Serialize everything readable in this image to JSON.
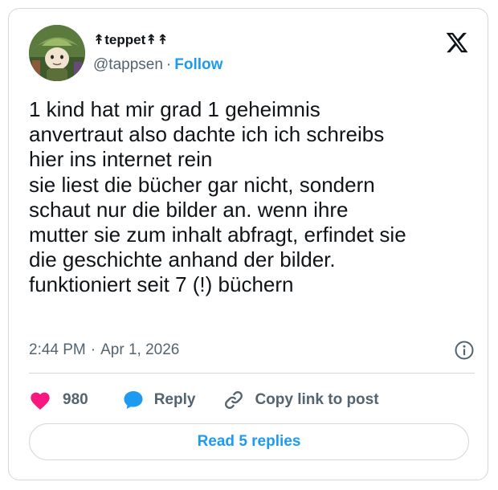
{
  "author": {
    "display_name": "↟teppet↟↟",
    "handle": "@tappsen",
    "separator": "·",
    "follow_label": "Follow",
    "avatar": "avatar-illustration"
  },
  "brand": {
    "logo": "x-logo-icon"
  },
  "tweet": {
    "text": "1 kind hat mir grad 1 geheimnis\nanvertraut also dachte ich ich schreibs\nhier ins internet rein\nsie liest die bücher gar nicht, sondern\nschaut nur die bilder an. wenn ihre\nmutter sie zum inhalt abfragt, erfindet sie\ndie geschichte anhand der bilder.\nfunktioniert seit 7 (!) büchern",
    "time": "2:44 PM",
    "separator": "·",
    "date": "Apr 1, 2026",
    "info_icon": "info-icon"
  },
  "actions": {
    "like_count": "980",
    "like_icon": "heart-icon",
    "reply_label": "Reply",
    "reply_icon": "speech-bubble-icon",
    "copy_label": "Copy link to post",
    "copy_icon": "link-icon"
  },
  "replies": {
    "button_label": "Read 5 replies"
  },
  "colors": {
    "accent": "#1d9bf0",
    "like": "#f91880",
    "text_primary": "#0f1419",
    "text_secondary": "#536471",
    "border": "#cfd9de"
  }
}
